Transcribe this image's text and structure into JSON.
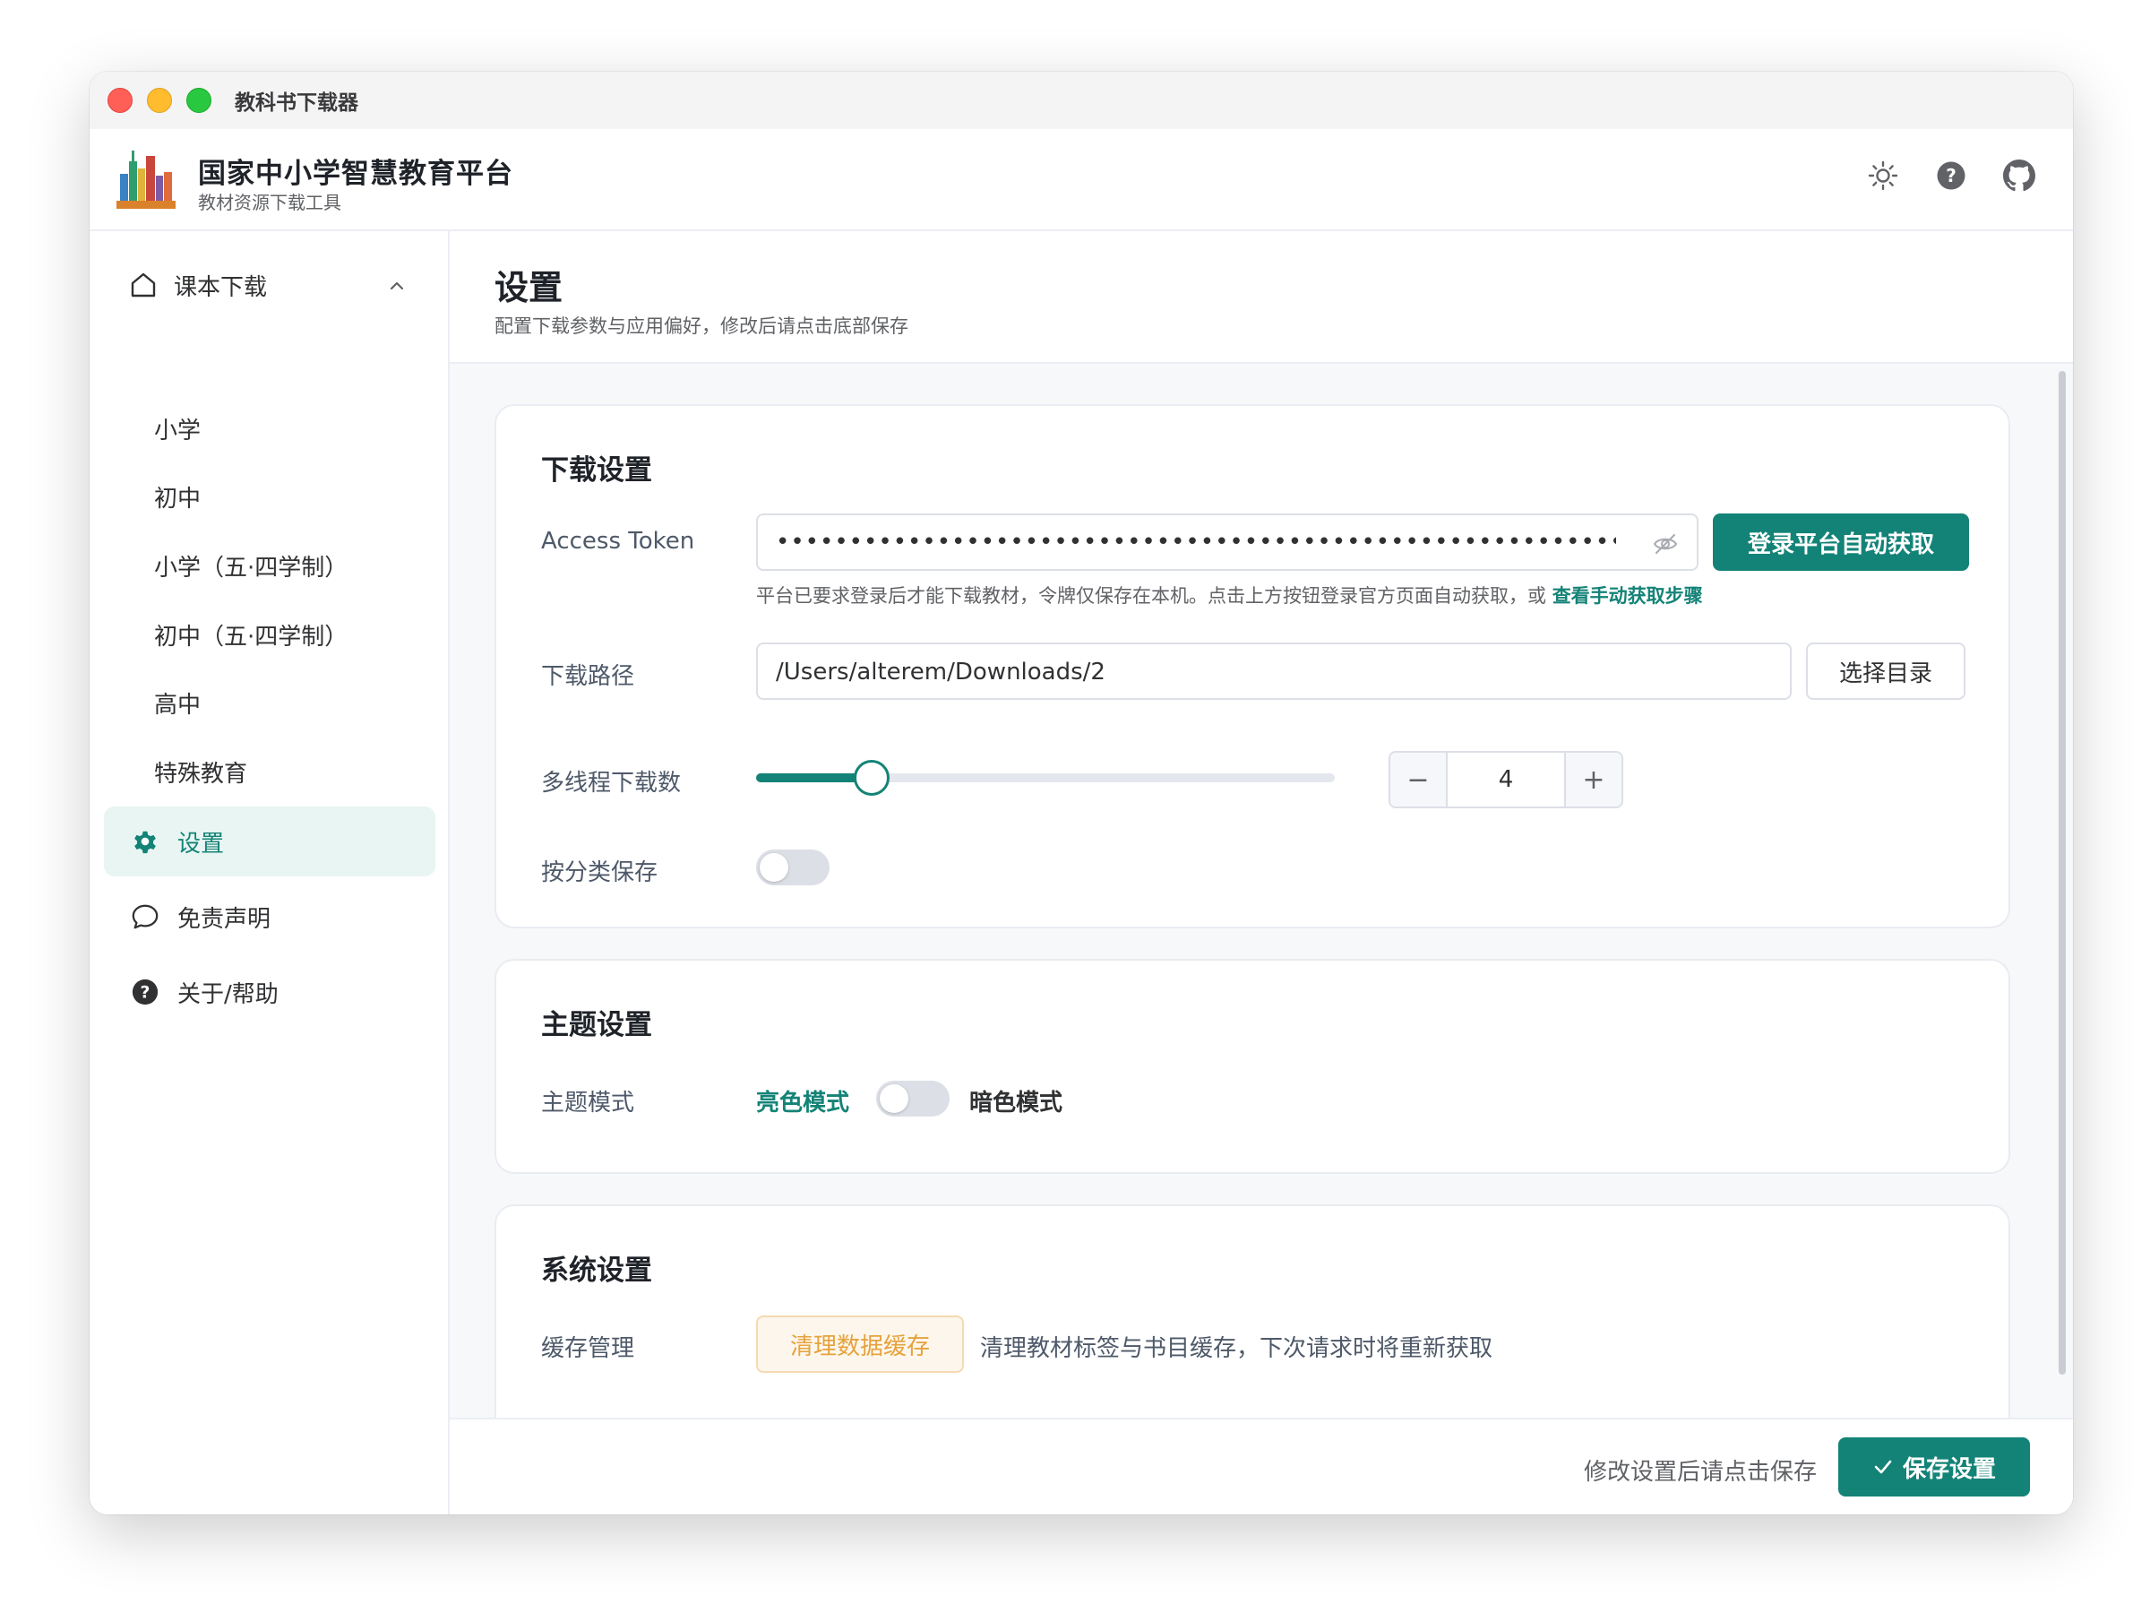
{
  "window": {
    "title": "教科书下载器"
  },
  "header": {
    "title": "国家中小学智慧教育平台",
    "subtitle": "教材资源下载工具",
    "icons": [
      "sun-icon",
      "help-icon",
      "github-icon"
    ]
  },
  "sidebar": {
    "group": {
      "label": "课本下载",
      "icon": "home-icon",
      "expanded": true
    },
    "subitems": [
      "小学",
      "初中",
      "小学（五·四学制）",
      "初中（五·四学制）",
      "高中",
      "特殊教育"
    ],
    "items": [
      {
        "label": "设置",
        "icon": "gear-icon",
        "active": true
      },
      {
        "label": "免责声明",
        "icon": "chat-icon",
        "active": false
      },
      {
        "label": "关于/帮助",
        "icon": "help-icon",
        "active": false
      }
    ]
  },
  "page": {
    "title": "设置",
    "subtitle": "配置下载参数与应用偏好，修改后请点击底部保存"
  },
  "download": {
    "title": "下载设置",
    "token_label": "Access Token",
    "token_value": "•••••••••••••••••••••••••••••••••••••••••••••••••••••••••••••",
    "login_button": "登录平台自动获取",
    "hint": "平台已要求登录后才能下载教材，令牌仅保存在本机。点击上方按钮登录官方页面自动获取，或",
    "hint_link": "查看手动获取步骤",
    "path_label": "下载路径",
    "path_value": "/Users/alterem/Downloads/2",
    "choose_dir": "选择目录",
    "threads_label": "多线程下载数",
    "threads": {
      "value": 4,
      "min": 1,
      "max": 16,
      "display": "4"
    },
    "classify_label": "按分类保存",
    "classify_enabled": false
  },
  "theme": {
    "title": "主题设置",
    "mode_label": "主题模式",
    "light": "亮色模式",
    "dark": "暗色模式",
    "dark_enabled": false
  },
  "system": {
    "title": "系统设置",
    "cache_label": "缓存管理",
    "clear_button": "清理数据缓存",
    "cache_desc": "清理教材标签与书目缓存，下次请求时将重新获取"
  },
  "footer": {
    "hint": "修改设置后请点击保存",
    "save_button": "保存设置"
  },
  "colors": {
    "accent": "#148377",
    "accent_light": "#e8f5f2",
    "warning": "#e6a23c"
  }
}
